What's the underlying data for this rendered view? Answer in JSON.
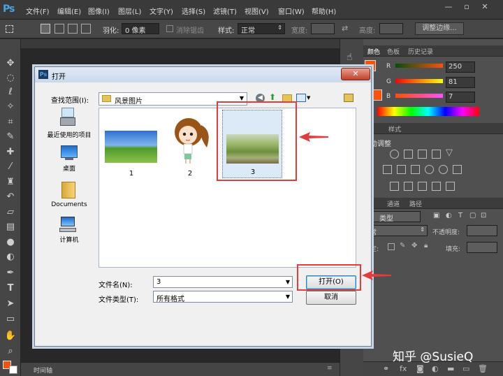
{
  "app": {
    "logo": "Ps"
  },
  "menus": [
    "文件(F)",
    "编辑(E)",
    "图像(I)",
    "图层(L)",
    "文字(Y)",
    "选择(S)",
    "滤镜(T)",
    "视图(V)",
    "窗口(W)",
    "帮助(H)"
  ],
  "window_controls": {
    "minimize": "—",
    "restore": "▫",
    "close": "✕"
  },
  "options": {
    "feather_label": "羽化:",
    "feather_value": "0 像素",
    "antialias_label": "消除锯齿",
    "style_label": "样式:",
    "style_value": "正常",
    "width_label": "宽度:",
    "height_label": "高度:",
    "refine_edge": "调整边缘..."
  },
  "panels": {
    "color_tabs": [
      "颜色",
      "色板",
      "历史记录"
    ],
    "rgb": [
      {
        "label": "R",
        "value": "250"
      },
      {
        "label": "G",
        "value": "81"
      },
      {
        "label": "B",
        "value": "7"
      }
    ],
    "adjust_tabs": [
      "整",
      "样式"
    ],
    "adjust_title": "动调整",
    "layers_tabs": [
      "层",
      "通道",
      "路径"
    ],
    "kind_label": "类型",
    "blend_mode": "常",
    "opacity_label": "不透明度:",
    "lock_label": "定:",
    "fill_label": "填充:"
  },
  "timeline_label": "时间轴",
  "dialog": {
    "title": "打开",
    "look_in_label": "查找范围(I):",
    "look_in_value": "风景图片",
    "places": [
      {
        "label": "最近使用的项目",
        "icon": "recent-items-icon"
      },
      {
        "label": "桌面",
        "icon": "desktop-icon"
      },
      {
        "label": "Documents",
        "icon": "documents-folder-icon"
      },
      {
        "label": "计算机",
        "icon": "computer-icon"
      }
    ],
    "files": [
      {
        "name": "1",
        "icon": "landscape-thumbnail"
      },
      {
        "name": "2",
        "icon": "cartoon-girl-thumbnail"
      },
      {
        "name": "3",
        "icon": "green-hills-thumbnail"
      }
    ],
    "filename_label": "文件名(N):",
    "filename_value": "3",
    "filetype_label": "文件类型(T):",
    "filetype_value": "所有格式",
    "open_button": "打开(O)",
    "cancel_button": "取消"
  },
  "colors": {
    "foreground": "#fa5107",
    "highlight": "#e23c3c",
    "ps_bg": "#282828"
  },
  "watermark": "知乎 @SusieQ"
}
